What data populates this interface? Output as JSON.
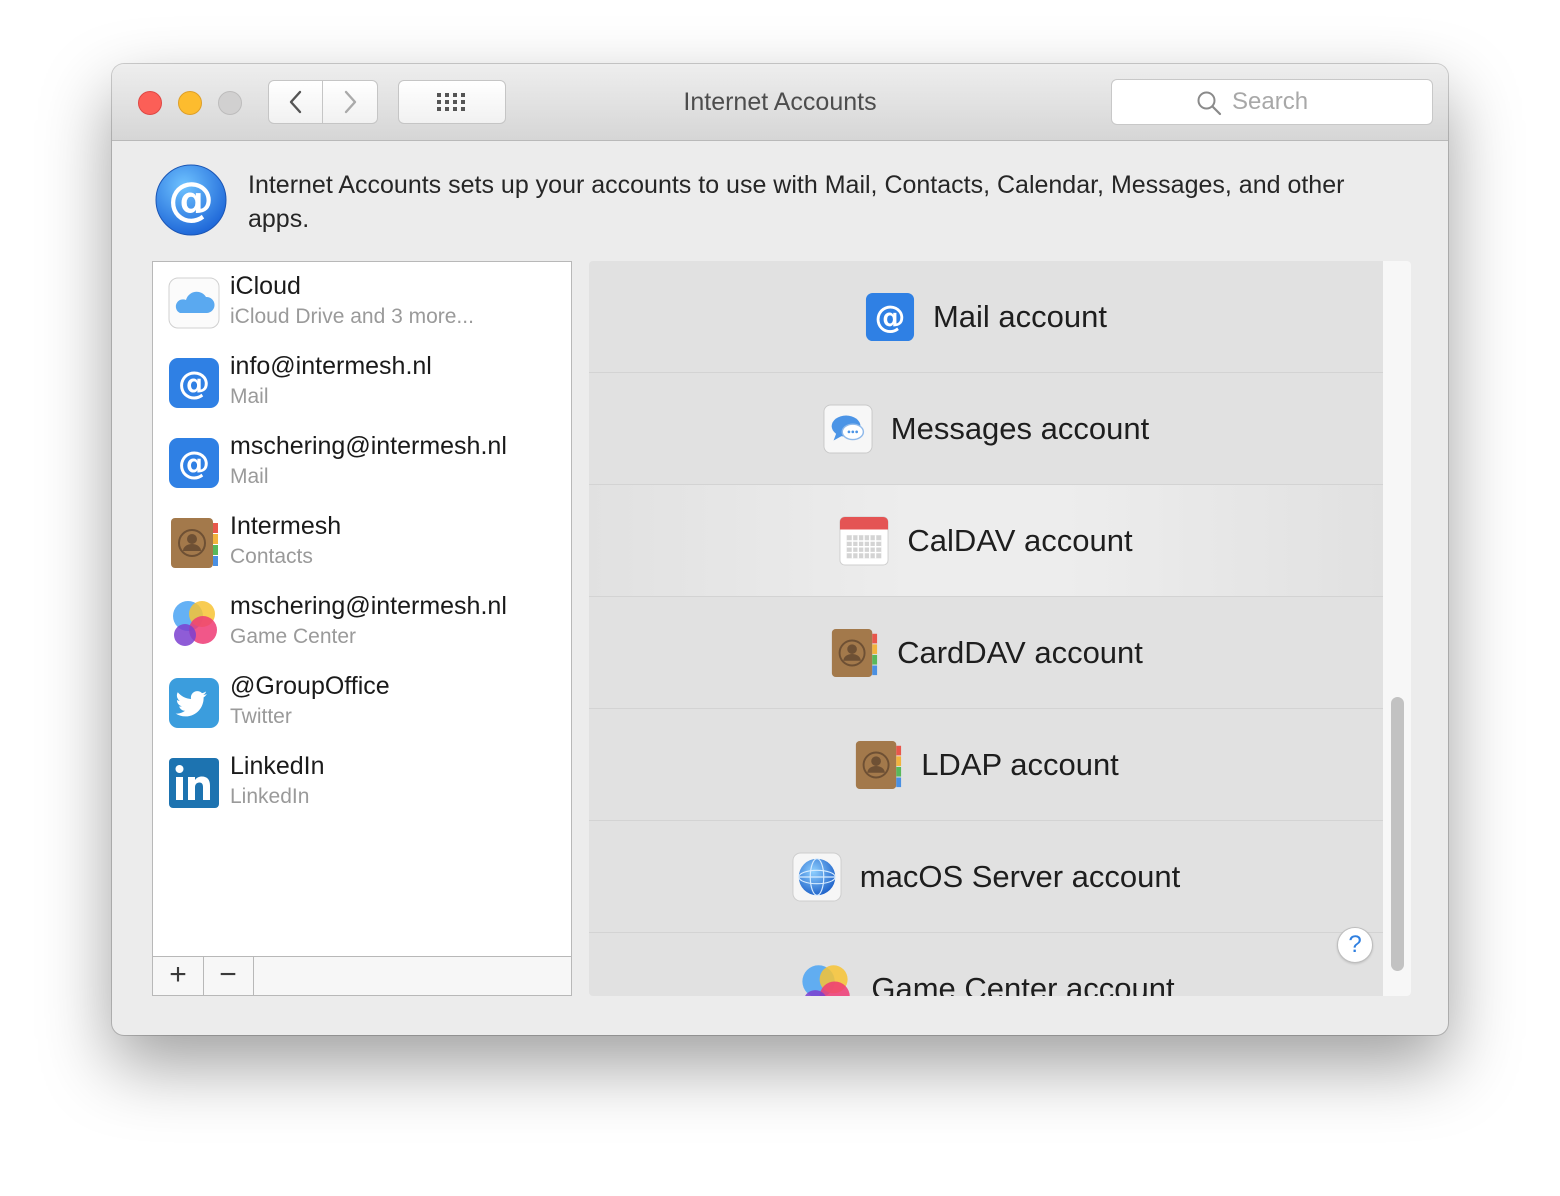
{
  "window": {
    "title": "Internet Accounts",
    "search_placeholder": "Search",
    "traffic_lights": [
      "close",
      "minimize",
      "zoom"
    ]
  },
  "header": {
    "icon": "at-sign-icon",
    "description": "Internet Accounts sets up your accounts to use with Mail, Contacts, Calendar, Messages, and other apps."
  },
  "accounts": [
    {
      "name": "iCloud",
      "subtitle": "iCloud Drive and 3 more...",
      "icon": "icloud-icon"
    },
    {
      "name": "info@intermesh.nl",
      "subtitle": "Mail",
      "icon": "mail-at-icon"
    },
    {
      "name": "mschering@intermesh.nl",
      "subtitle": "Mail",
      "icon": "mail-at-icon"
    },
    {
      "name": "Intermesh",
      "subtitle": "Contacts",
      "icon": "contacts-icon"
    },
    {
      "name": "mschering@intermesh.nl",
      "subtitle": "Game Center",
      "icon": "game-center-icon"
    },
    {
      "name": "@GroupOffice",
      "subtitle": "Twitter",
      "icon": "twitter-icon"
    },
    {
      "name": "LinkedIn",
      "subtitle": "LinkedIn",
      "icon": "linkedin-icon"
    }
  ],
  "list_toolbar": {
    "add_label": "+",
    "remove_label": "−"
  },
  "providers": [
    {
      "label": "Mail account",
      "icon": "mail-at-icon"
    },
    {
      "label": "Messages account",
      "icon": "messages-icon"
    },
    {
      "label": "CalDAV account",
      "icon": "calendar-icon",
      "highlighted": true
    },
    {
      "label": "CardDAV account",
      "icon": "contacts-icon"
    },
    {
      "label": "LDAP account",
      "icon": "contacts-icon"
    },
    {
      "label": "macOS Server account",
      "icon": "server-globe-icon"
    },
    {
      "label": "Game Center account",
      "icon": "game-center-icon"
    }
  ],
  "help_label": "?",
  "colors": {
    "accent": "#2f7fe0",
    "close": "#fc5f57",
    "minimize": "#fdbc2e",
    "zoom": "#d1d0d0"
  }
}
